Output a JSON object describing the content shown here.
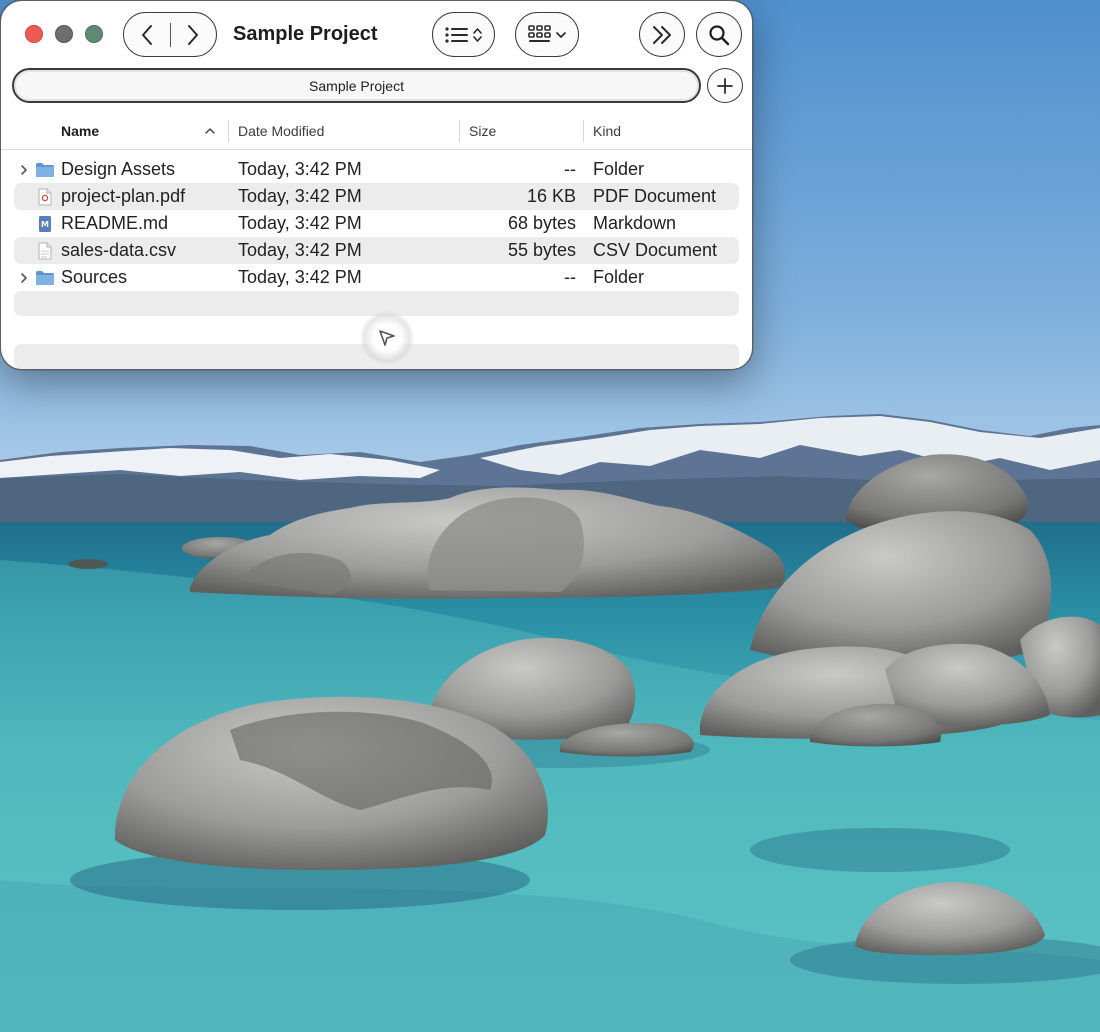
{
  "window": {
    "title": "Sample Project",
    "tab_title": "Sample Project"
  },
  "toolbar": {
    "back_icon": "chevron-left-icon",
    "forward_icon": "chevron-right-icon",
    "view_list_icon": "list-icon",
    "view_grid_icon": "grid-icon",
    "more_icon": "double-chevron-right-icon",
    "search_icon": "search-icon",
    "add_tab_icon": "plus-icon"
  },
  "columns": {
    "name": "Name",
    "date": "Date Modified",
    "size": "Size",
    "kind": "Kind"
  },
  "files": [
    {
      "name": "Design Assets",
      "date": "Today, 3:42 PM",
      "size": "--",
      "kind": "Folder",
      "icon": "folder-icon"
    },
    {
      "name": "project-plan.pdf",
      "date": "Today, 3:42 PM",
      "size": "16 KB",
      "kind": "PDF Document",
      "icon": "pdf-file-icon"
    },
    {
      "name": "README.md",
      "date": "Today, 3:42 PM",
      "size": "68 bytes",
      "kind": "Markdown",
      "icon": "markdown-file-icon"
    },
    {
      "name": "sales-data.csv",
      "date": "Today, 3:42 PM",
      "size": "55 bytes",
      "kind": "CSV Document",
      "icon": "csv-file-icon"
    },
    {
      "name": "Sources",
      "date": "Today, 3:42 PM",
      "size": "--",
      "kind": "Folder",
      "icon": "folder-icon"
    }
  ],
  "colors": {
    "close": "#ec5a54",
    "minimize": "#6e6e6e",
    "zoom": "#5e8a73",
    "folder": "#6fa3d8",
    "stripe": "#ececec"
  }
}
